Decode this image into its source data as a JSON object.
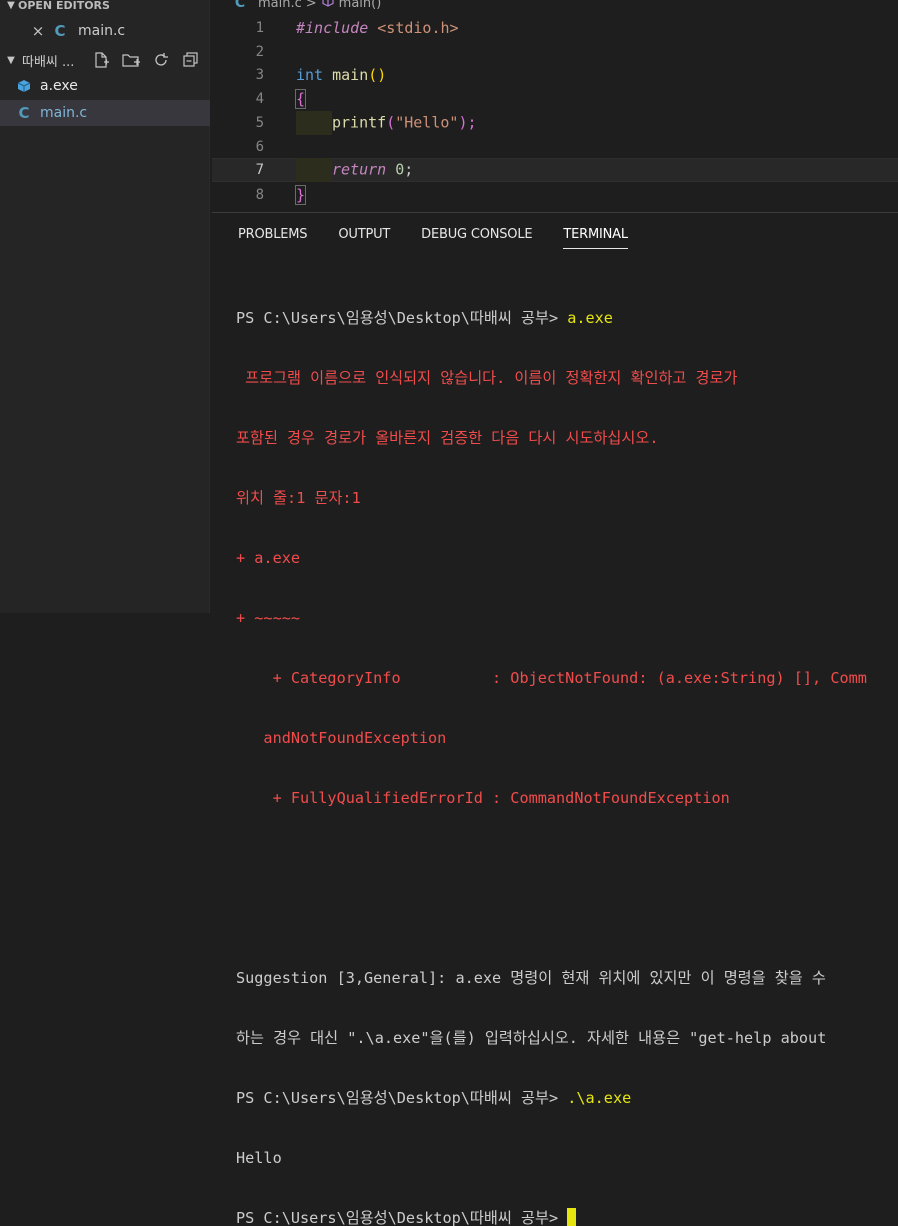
{
  "sidebar": {
    "open_editors_label": "OPEN EDITORS",
    "open_file": "main.c",
    "folder_label": "따배씨 ...",
    "files": [
      {
        "name": "a.exe",
        "icon": "package-icon"
      },
      {
        "name": "main.c",
        "icon": "c-file-icon"
      }
    ],
    "c_glyph": "C"
  },
  "breadcrumb": {
    "file": "main.c",
    "separator": ">",
    "symbol": "main()"
  },
  "editor": {
    "line_numbers": [
      "1",
      "2",
      "3",
      "4",
      "5",
      "6",
      "7",
      "8"
    ],
    "line1": {
      "directive": "#include",
      "header": "<stdio.h>"
    },
    "line3": {
      "type": "int",
      "fn": "main",
      "parens": "()"
    },
    "line4": {
      "brace": "{"
    },
    "line5": {
      "fn": "printf",
      "open": "(",
      "string": "\"Hello\"",
      "close": ");"
    },
    "line7": {
      "kw": "return",
      "num": "0",
      "semi": ";"
    },
    "line8": {
      "brace": "}"
    }
  },
  "panel": {
    "tabs": [
      "PROBLEMS",
      "OUTPUT",
      "DEBUG CONSOLE",
      "TERMINAL"
    ],
    "active_tab": "TERMINAL"
  },
  "terminal": {
    "prompt": "PS C:\\Users\\임용성\\Desktop\\따배씨 공부> ",
    "cmd1": "a.exe",
    "err_lines": [
      " 프로그램 이름으로 인식되지 않습니다. 이름이 정확한지 확인하고 경로가",
      "포함된 경우 경로가 올바른지 검증한 다음 다시 시도하십시오.",
      "위치 줄:1 문자:1",
      "+ a.exe",
      "+ ~~~~~",
      "    + CategoryInfo          : ObjectNotFound: (a.exe:String) [], Comm",
      "   andNotFoundException",
      "    + FullyQualifiedErrorId : CommandNotFoundException"
    ],
    "suggestion_lines": [
      "Suggestion [3,General]: a.exe 명령이 현재 위치에 있지만 이 명령을 찾을 수",
      "하는 경우 대신 \".\\a.exe\"을(를) 입력하십시오. 자세한 내용은 \"get-help about"
    ],
    "cmd2": ".\\a.exe",
    "output": "Hello"
  },
  "colors": {
    "error": "#f14c4c",
    "command": "#e5e510",
    "background": "#1e1e1e"
  }
}
